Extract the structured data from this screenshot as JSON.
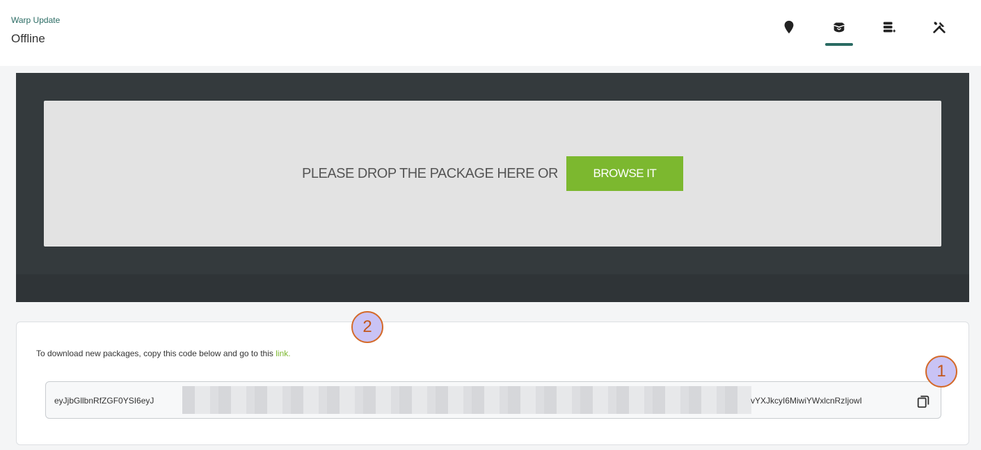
{
  "header": {
    "app_subtitle": "Warp Update",
    "status_title": "Offline"
  },
  "tabs": [
    {
      "name": "location",
      "icon": "map-pin-icon",
      "active": false
    },
    {
      "name": "packages",
      "icon": "package-box-icon",
      "active": true
    },
    {
      "name": "database",
      "icon": "database-add-icon",
      "active": false
    },
    {
      "name": "tools",
      "icon": "tools-icon",
      "active": false
    }
  ],
  "drop_zone": {
    "text": "PLEASE DROP THE PACKAGE HERE OR",
    "browse_label": "BROWSE IT"
  },
  "download_card": {
    "instruction_text": "To download new packages, copy this code below and go to this",
    "link_label": "link.",
    "code_prefix": "eyJjbGllbnRfZGF0YSI6eyJ",
    "code_suffix": "vYXJkcyI6MiwiYWxlcnRzIjowI",
    "copy_icon": "copy-icon"
  },
  "annotations": {
    "callout_1": "1",
    "callout_2": "2"
  },
  "colors": {
    "accent_teal": "#2a6b63",
    "brand_green": "#7cb82f",
    "dark_panel": "#343a3d",
    "callout_border": "#d46a2a",
    "callout_fill": "#c9c3f5"
  }
}
